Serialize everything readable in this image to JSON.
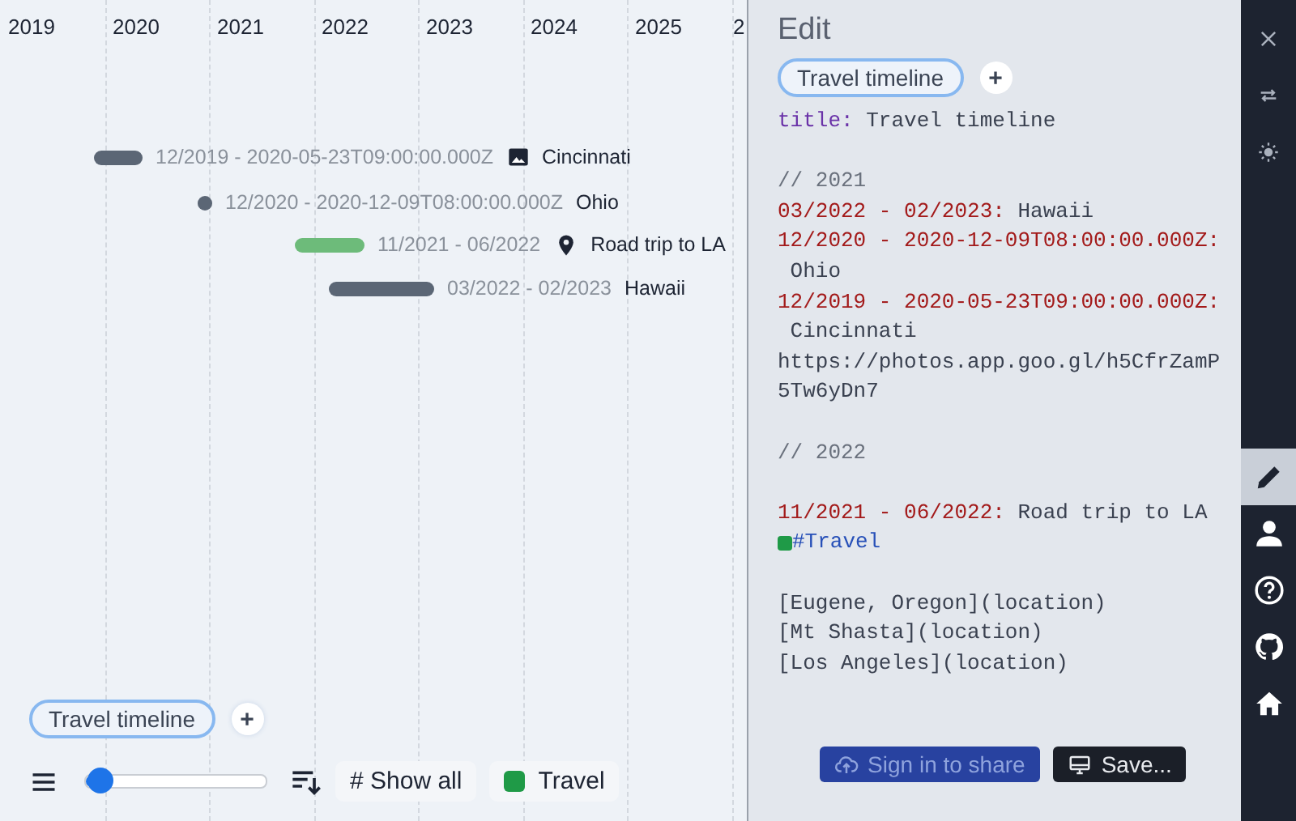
{
  "timeline": {
    "years": [
      "2019",
      "2020",
      "2021",
      "2022",
      "2023",
      "2024",
      "2025",
      "2"
    ],
    "events": [
      {
        "kind": "range",
        "dates": "12/2019 - 2020-05-23T09:00:00.000Z",
        "name": "Cincinnati",
        "color": "#5b6675"
      },
      {
        "kind": "point",
        "dates": "12/2020 - 2020-12-09T08:00:00.000Z",
        "name": "Ohio",
        "color": "#5b6675"
      },
      {
        "kind": "range",
        "dates": "11/2021 - 06/2022",
        "name": "Road trip to LA",
        "color": "#6dbb7a"
      },
      {
        "kind": "range",
        "dates": "03/2022 - 02/2023",
        "name": "Hawaii",
        "color": "#5b6675"
      }
    ]
  },
  "bottom_bar": {
    "tabs": [
      {
        "label": "Travel timeline",
        "selected": true
      }
    ],
    "add_label": "+",
    "zoom": {
      "level": 0.08
    },
    "show_all": "# Show all",
    "tags": [
      {
        "label": "Travel",
        "color": "#1f9a47"
      }
    ]
  },
  "editor": {
    "title": "Edit",
    "tabs": [
      {
        "label": "Travel timeline",
        "selected": true
      }
    ],
    "add_label": "+",
    "lines": [
      {
        "kind": "code",
        "parts": [
          {
            "kind": "key",
            "text": "title:"
          },
          {
            "kind": "text",
            "text": " Travel timeline"
          }
        ]
      },
      {
        "kind": "blank"
      },
      {
        "kind": "code",
        "parts": [
          {
            "kind": "comment",
            "text": "// 2021"
          }
        ]
      },
      {
        "kind": "code",
        "parts": [
          {
            "kind": "date",
            "text": "03/2022 - 02/2023:"
          },
          {
            "kind": "text",
            "text": " Hawaii"
          }
        ]
      },
      {
        "kind": "code",
        "parts": [
          {
            "kind": "date",
            "text": "12/2020 - 2020-12-09T08:00:00.000Z:"
          }
        ]
      },
      {
        "kind": "code",
        "parts": [
          {
            "kind": "text",
            "text": " Ohio"
          }
        ]
      },
      {
        "kind": "code",
        "parts": [
          {
            "kind": "date",
            "text": "12/2019 - 2020-05-23T09:00:00.000Z:"
          }
        ]
      },
      {
        "kind": "code",
        "parts": [
          {
            "kind": "text",
            "text": " Cincinnati"
          }
        ]
      },
      {
        "kind": "code",
        "parts": [
          {
            "kind": "text",
            "text": "https://photos.app.goo.gl/h5CfrZamP"
          }
        ]
      },
      {
        "kind": "code",
        "parts": [
          {
            "kind": "text",
            "text": "5Tw6yDn7"
          }
        ]
      },
      {
        "kind": "blank"
      },
      {
        "kind": "code",
        "parts": [
          {
            "kind": "comment",
            "text": "// 2022"
          }
        ]
      },
      {
        "kind": "blank"
      },
      {
        "kind": "code",
        "parts": [
          {
            "kind": "date",
            "text": "11/2021 - 06/2022:"
          },
          {
            "kind": "text",
            "text": " Road trip to LA"
          }
        ]
      },
      {
        "kind": "tag",
        "color": "#1f9a47",
        "text": "#Travel"
      },
      {
        "kind": "blank"
      },
      {
        "kind": "code",
        "parts": [
          {
            "kind": "text",
            "text": "[Eugene, Oregon](location)"
          }
        ]
      },
      {
        "kind": "code",
        "parts": [
          {
            "kind": "text",
            "text": "[Mt Shasta](location)"
          }
        ]
      },
      {
        "kind": "code",
        "parts": [
          {
            "kind": "text",
            "text": "[Los Angeles](location)"
          }
        ]
      }
    ],
    "buttons": [
      {
        "kind": "share",
        "label": "Sign in to share"
      },
      {
        "kind": "save",
        "label": "Save..."
      }
    ]
  },
  "sidebar": {
    "items": [
      {
        "kind": "close",
        "selected": false
      },
      {
        "kind": "swap",
        "selected": false
      },
      {
        "kind": "theme",
        "selected": false
      },
      {
        "kind": "edit",
        "selected": true
      },
      {
        "kind": "profile",
        "selected": false
      },
      {
        "kind": "help",
        "selected": false
      },
      {
        "kind": "repo",
        "selected": false
      },
      {
        "kind": "home",
        "selected": false
      }
    ]
  }
}
